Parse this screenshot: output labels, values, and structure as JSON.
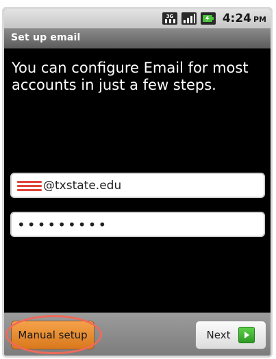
{
  "status_bar": {
    "network_badge": "3G",
    "time": "4:24",
    "ampm": "PM",
    "icons": [
      "network-3g-icon",
      "signal-icon",
      "battery-icon"
    ]
  },
  "title_bar": {
    "title": "Set up email"
  },
  "intro": {
    "text": "You can configure Email for most accounts in just a few steps."
  },
  "form": {
    "email_value": "@txstate.edu",
    "password_value": "•••••••••"
  },
  "buttons": {
    "manual_setup_label": "Manual setup",
    "next_label": "Next"
  },
  "colors": {
    "highlight_ring": "#ef6a5a",
    "manual_button": "#e8892c",
    "next_arrow": "#3db52f",
    "screen_background": "#000000"
  }
}
